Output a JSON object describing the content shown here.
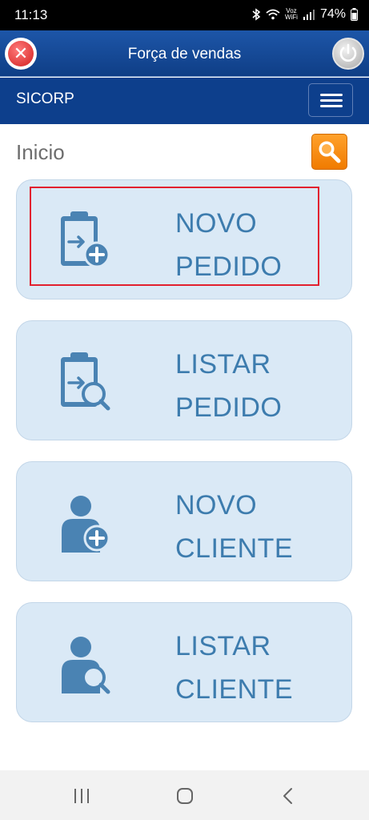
{
  "status_bar": {
    "time": "11:13",
    "voz_top": "Voz",
    "voz_bottom": "WiFi",
    "battery": "74%"
  },
  "titlebar": {
    "title": "Força de vendas",
    "close_icon": "close-icon",
    "power_icon": "power-icon"
  },
  "navbar": {
    "brand": "SICORP",
    "menu_icon": "hamburger-menu-icon"
  },
  "page": {
    "title": "Inicio",
    "search_icon": "search-icon"
  },
  "cards": [
    {
      "line1": "NOVO",
      "line2": "PEDIDO",
      "icon": "clipboard-add-icon",
      "selected": true
    },
    {
      "line1": "LISTAR",
      "line2": "PEDIDO",
      "icon": "clipboard-search-icon",
      "selected": false
    },
    {
      "line1": "NOVO",
      "line2": "CLIENTE",
      "icon": "user-add-icon",
      "selected": false
    },
    {
      "line1": "LISTAR",
      "line2": "CLIENTE",
      "icon": "user-search-icon",
      "selected": false
    }
  ],
  "colors": {
    "header": "#0d3f8c",
    "card_bg": "#dae9f6",
    "card_text": "#3d7cae",
    "accent_orange": "#f58a0a",
    "highlight": "#e2202f"
  }
}
